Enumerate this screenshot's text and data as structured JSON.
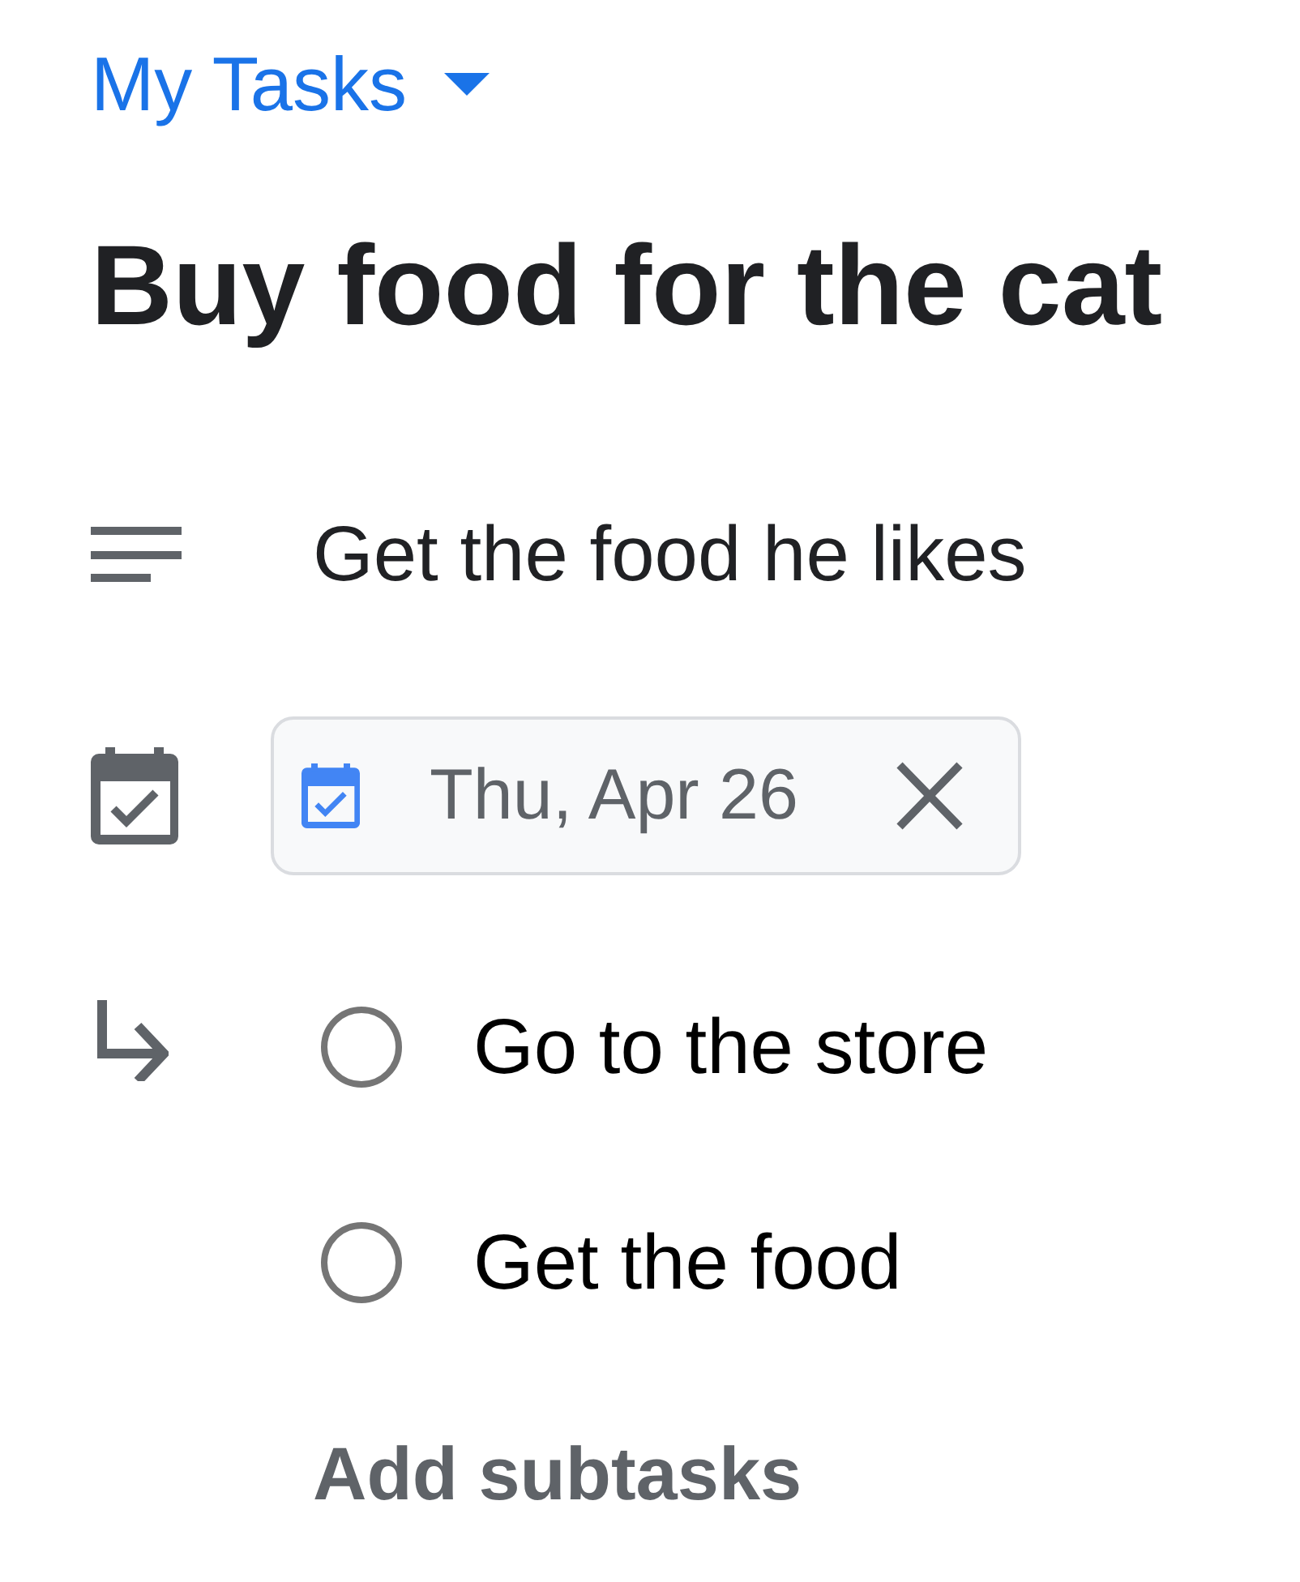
{
  "list_selector": {
    "label": "My Tasks"
  },
  "task": {
    "title": "Buy food for the cat",
    "details": "Get the food he likes",
    "due_date": "Thu, Apr 26"
  },
  "subtasks": [
    {
      "title": "Go to the store",
      "checked": false
    },
    {
      "title": "Get the food",
      "checked": false
    }
  ],
  "add_subtasks": {
    "label": "Add subtasks"
  }
}
